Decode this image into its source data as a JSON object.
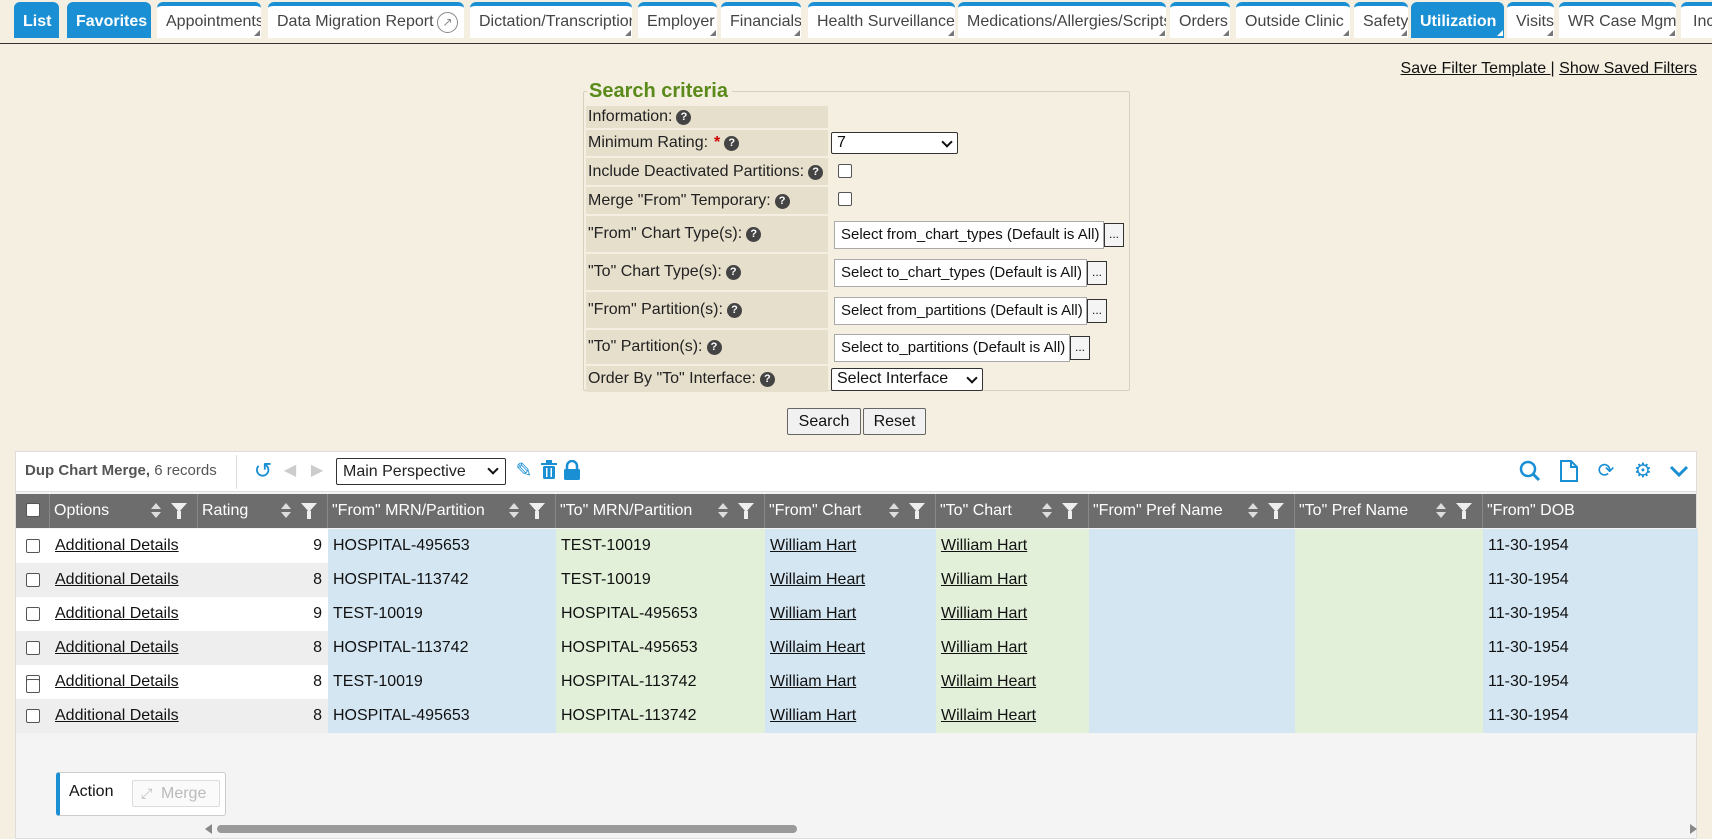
{
  "tabs": [
    {
      "label": "List",
      "active": true
    },
    {
      "label": "Favorites",
      "active": true
    },
    {
      "label": "Appointments"
    },
    {
      "label": "Data Migration Report",
      "icon": "external-link-icon"
    },
    {
      "label": "Dictation/Transcription"
    },
    {
      "label": "Employer"
    },
    {
      "label": "Financials"
    },
    {
      "label": "Health Surveillance"
    },
    {
      "label": "Medications/Allergies/Scripts"
    },
    {
      "label": "Orders"
    },
    {
      "label": "Outside Clinic"
    },
    {
      "label": "Safety"
    },
    {
      "label": "Utilization",
      "active": true
    },
    {
      "label": "Visits"
    },
    {
      "label": "WR Case Mgmt"
    },
    {
      "label": "Inc"
    }
  ],
  "toplinks": {
    "save_filter": "Save Filter Template ",
    "separator": "|",
    "show_saved": "Show Saved Filters"
  },
  "criteria": {
    "title": "Search criteria",
    "information_label": "Information:",
    "min_rating_label": "Minimum Rating:",
    "required_mark": "*",
    "min_rating_value": "7",
    "include_deactivated_label": "Include Deactivated Partitions:",
    "merge_from_temp_label": "Merge \"From\" Temporary:",
    "from_chart_types_label": "\"From\" Chart Type(s):",
    "from_chart_types_value": "Select from_chart_types (Default is All)",
    "to_chart_types_label": "\"To\" Chart Type(s):",
    "to_chart_types_value": "Select to_chart_types (Default is All)",
    "from_partitions_label": "\"From\" Partition(s):",
    "from_partitions_value": "Select from_partitions (Default is All)",
    "to_partitions_label": "\"To\" Partition(s):",
    "to_partitions_value": "Select to_partitions (Default is All)",
    "order_by_label": "Order By \"To\" Interface:",
    "order_by_value": "Select Interface",
    "picker_dots": "...",
    "help_glyph": "?",
    "search_button": "Search",
    "reset_button": "Reset"
  },
  "grid": {
    "title": "Dup Chart Merge,",
    "record_count": "6 records",
    "perspective": "Main Perspective",
    "columns": [
      "Options",
      "Rating",
      "\"From\" MRN/Partition",
      "\"To\" MRN/Partition",
      "\"From\" Chart",
      "\"To\" Chart",
      "\"From\" Pref Name",
      "\"To\" Pref Name",
      "\"From\" DOB"
    ],
    "rows": [
      {
        "options": "Additional Details",
        "rating": "9",
        "from_mrn": "HOSPITAL-495653",
        "to_mrn": "TEST-10019",
        "from_chart": "William Hart",
        "to_chart": "William Hart",
        "from_pref": "",
        "to_pref": "",
        "from_dob": "11-30-1954"
      },
      {
        "options": "Additional Details",
        "rating": "8",
        "from_mrn": "HOSPITAL-113742",
        "to_mrn": "TEST-10019",
        "from_chart": "Willaim Heart",
        "to_chart": "William Hart",
        "from_pref": "",
        "to_pref": "",
        "from_dob": "11-30-1954"
      },
      {
        "options": "Additional Details",
        "rating": "9",
        "from_mrn": "TEST-10019",
        "to_mrn": "HOSPITAL-495653",
        "from_chart": "William Hart",
        "to_chart": "William Hart",
        "from_pref": "",
        "to_pref": "",
        "from_dob": "11-30-1954"
      },
      {
        "options": "Additional Details",
        "rating": "8",
        "from_mrn": "HOSPITAL-113742",
        "to_mrn": "HOSPITAL-495653",
        "from_chart": "Willaim Heart",
        "to_chart": "William Hart",
        "from_pref": "",
        "to_pref": "",
        "from_dob": "11-30-1954"
      },
      {
        "options": "Additional Details",
        "rating": "8",
        "from_mrn": "TEST-10019",
        "to_mrn": "HOSPITAL-113742",
        "from_chart": "William Hart",
        "to_chart": "Willaim Heart",
        "from_pref": "",
        "to_pref": "",
        "from_dob": "11-30-1954"
      },
      {
        "options": "Additional Details",
        "rating": "8",
        "from_mrn": "HOSPITAL-495653",
        "to_mrn": "HOSPITAL-113742",
        "from_chart": "William Hart",
        "to_chart": "Willaim Heart",
        "from_pref": "",
        "to_pref": "",
        "from_dob": "11-30-1954"
      }
    ],
    "action_label": "Action",
    "merge_label": "Merge"
  },
  "colors": {
    "accent": "#1a8fd4",
    "page_bg": "#f5efe1",
    "criteria_title": "#5a8a1a",
    "from_column_bg": "#d4e6f2",
    "to_column_bg": "#e2f0d9",
    "header_bg": "#6d6d6d"
  }
}
